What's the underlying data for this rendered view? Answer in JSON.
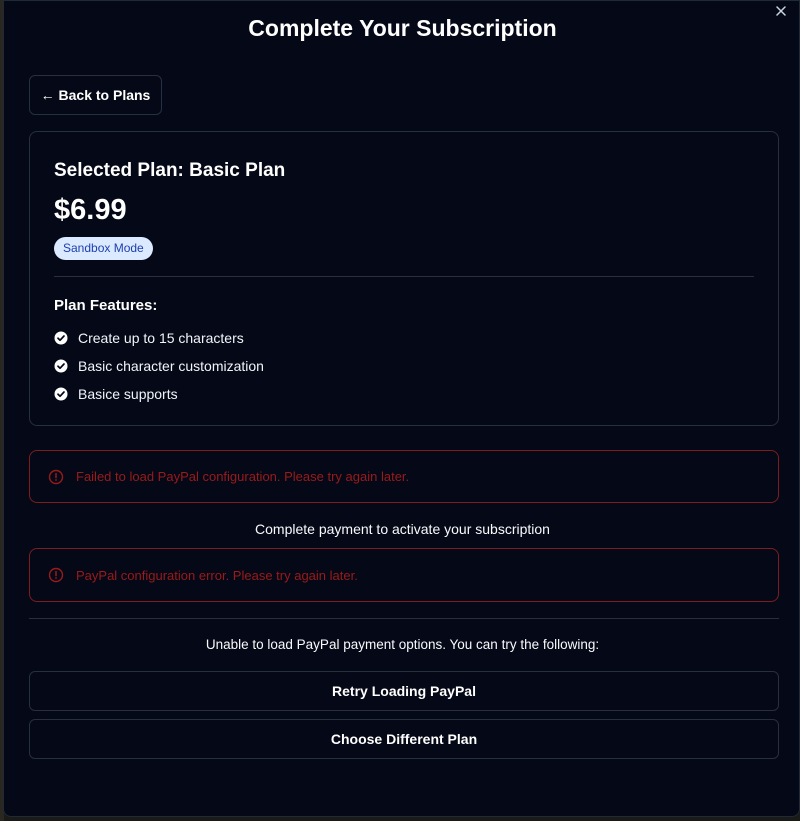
{
  "modal": {
    "title": "Complete Your Subscription",
    "close_icon": "close-icon",
    "back_label": "← Back to Plans"
  },
  "plan": {
    "name": "Selected Plan: Basic Plan",
    "price": "$6.99",
    "mode_badge": "Sandbox Mode",
    "features_heading": "Plan Features:",
    "features": [
      "Create up to 15 characters",
      "Basic character customization",
      "Basice supports"
    ],
    "feature_icon": "check-circle-icon"
  },
  "errors": {
    "config_load": "Failed to load PayPal configuration. Please try again later.",
    "config_error": "PayPal configuration error. Please try again later.",
    "icon": "alert-circle-icon"
  },
  "payment": {
    "note": "Complete payment to activate your subscription",
    "fallback_note": "Unable to load PayPal payment options. You can try the following:",
    "retry_label": "Retry Loading PayPal",
    "choose_plan_label": "Choose Different Plan"
  },
  "colors": {
    "background": "#050816",
    "border": "#263041",
    "error_border": "#7f1d1d",
    "error_text": "#991b1b",
    "badge_bg": "#dbeafe",
    "badge_text": "#1e40af"
  }
}
